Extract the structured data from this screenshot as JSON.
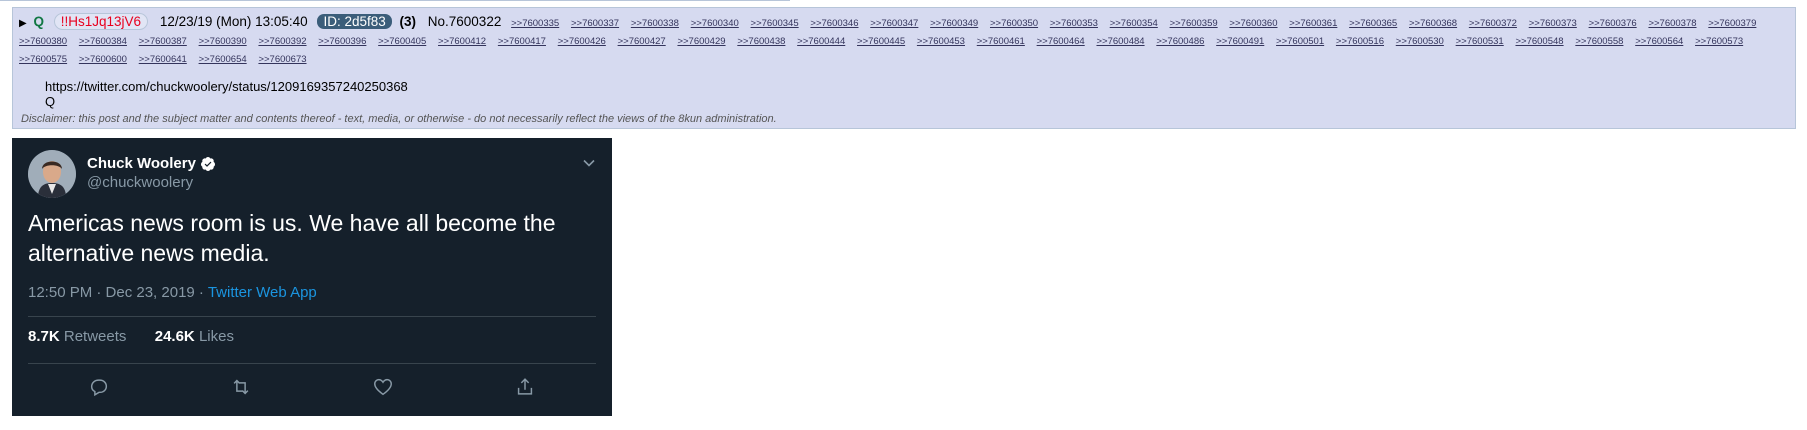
{
  "post": {
    "name": "Q",
    "tripcode": "!!Hs1Jq13jV6",
    "date": "12/23/19 (Mon) 13:05:40",
    "id_label": "ID: 2d5f83",
    "id_count": "(3)",
    "post_number": "No.7600322",
    "backlinks": [
      ">>7600335",
      ">>7600337",
      ">>7600338",
      ">>7600340",
      ">>7600345",
      ">>7600346",
      ">>7600347",
      ">>7600349",
      ">>7600350",
      ">>7600353",
      ">>7600354",
      ">>7600359",
      ">>7600360",
      ">>7600361",
      ">>7600365",
      ">>7600368",
      ">>7600372",
      ">>7600373",
      ">>7600376",
      ">>7600378",
      ">>7600379",
      ">>7600380",
      ">>7600384",
      ">>7600387",
      ">>7600390",
      ">>7600392",
      ">>7600396",
      ">>7600405",
      ">>7600412",
      ">>7600417",
      ">>7600426",
      ">>7600427",
      ">>7600429",
      ">>7600438",
      ">>7600444",
      ">>7600445",
      ">>7600453",
      ">>7600461",
      ">>7600464",
      ">>7600484",
      ">>7600486",
      ">>7600491",
      ">>7600501",
      ">>7600516",
      ">>7600530",
      ">>7600531",
      ">>7600548",
      ">>7600558",
      ">>7600564",
      ">>7600573",
      ">>7600575",
      ">>7600600",
      ">>7600641",
      ">>7600654",
      ">>7600673"
    ],
    "body_link": "https://twitter.com/chuckwoolery/status/1209169357240250368",
    "body_sig": "Q",
    "disclaimer": "Disclaimer: this post and the subject matter and contents thereof - text, media, or otherwise - do not necessarily reflect the views of the 8kun administration."
  },
  "tweet": {
    "author_name": "Chuck Woolery",
    "handle": "@chuckwoolery",
    "text": "Americas news room is us. We have all become the alternative news media.",
    "time": "12:50 PM · Dec 23, 2019 · ",
    "source": "Twitter Web App",
    "retweets_count": "8.7K",
    "retweets_label": "Retweets",
    "likes_count": "24.6K",
    "likes_label": "Likes"
  },
  "colors": {
    "post_bg": "#d6daf0",
    "trip": "#e8001e",
    "name": "#117743",
    "tweet_bg": "#15202b",
    "link_blue": "#1b95e0"
  }
}
